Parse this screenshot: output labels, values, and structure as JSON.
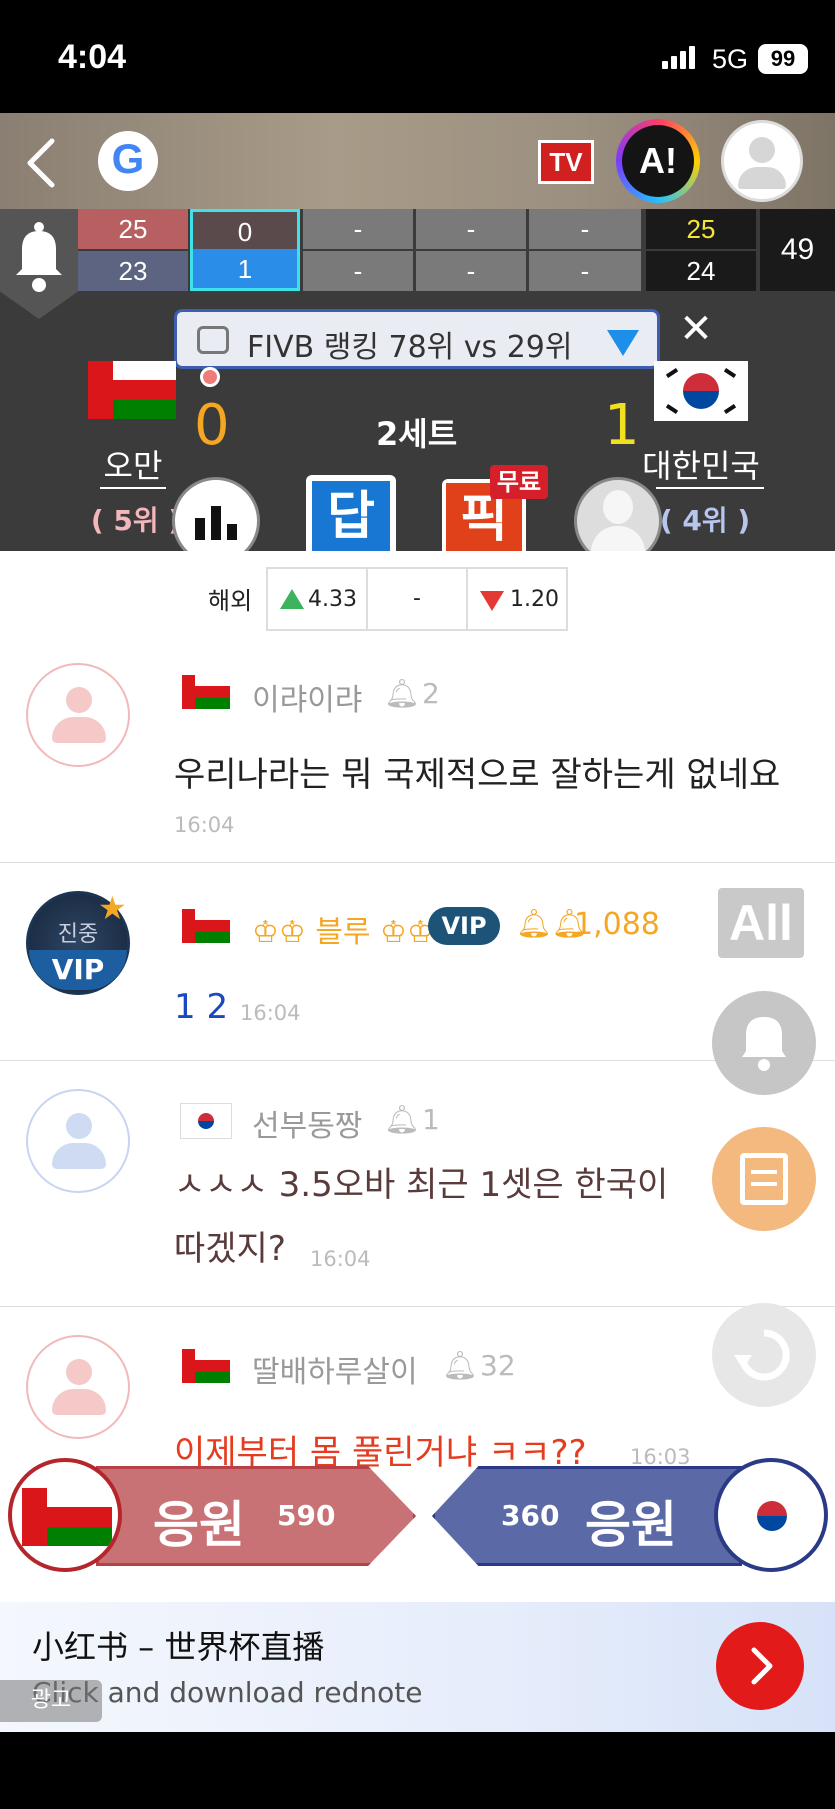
{
  "status_bar": {
    "time": "4:04",
    "network": "5G",
    "battery": "99"
  },
  "header": {
    "tv_label": "TV",
    "ai_label": "A!",
    "google_letter": "G"
  },
  "scoreboard": {
    "home_sets": [
      "25",
      "0",
      "-",
      "-",
      "-"
    ],
    "away_sets": [
      "23",
      "1",
      "-",
      "-",
      "-"
    ],
    "home_current": "25",
    "away_current": "24",
    "total": "49"
  },
  "ranking_pill": {
    "text": "FIVB 랭킹 78위 vs 29위"
  },
  "match": {
    "set_label": "2세트",
    "home": {
      "name": "오만",
      "rank": "( 5위 )",
      "score": "0"
    },
    "away": {
      "name": "대한민국",
      "rank": "( 4위 )",
      "score": "1"
    },
    "answer_label": "답",
    "pick_label": "픽",
    "free_badge": "무료"
  },
  "odds": {
    "label": "해외",
    "home": "4.33",
    "draw": "-",
    "away": "1.20"
  },
  "comments": [
    {
      "nick": "이랴이랴",
      "level": "2",
      "text": "우리나라는 뭐 국제적으로 잘하는게 없네요",
      "time": "16:04",
      "flag": "om"
    },
    {
      "nick": "♔♔ 블루 ♔♔",
      "vip_label": "VIP",
      "level": "1,088",
      "text": "1 2",
      "time": "16:04",
      "flag": "om",
      "avatar_text": "진중",
      "avatar_vip": "VIP"
    },
    {
      "nick": "선부동짱",
      "level": "1",
      "text": "ㅅㅅㅅ 3.5오바 최근 1셋은 한국이",
      "text2": "따겠지?",
      "time": "16:04",
      "flag": "kr"
    },
    {
      "nick": "딸배하루살이",
      "level": "32",
      "text": "이제부터 몸 풀린거냐 ㅋㅋ??",
      "time": "16:03",
      "flag": "om"
    }
  ],
  "side_buttons": {
    "all_label": "All"
  },
  "cheer": {
    "home_label": "응원",
    "home_count": "590",
    "away_label": "응원",
    "away_count": "360"
  },
  "ad": {
    "title": "小红书 – 世界杯直播",
    "subtitle": "Click and download rednote",
    "badge": "광고"
  },
  "colors": {
    "accent_orange": "#f5a623",
    "home_cheer": "#c97276",
    "away_cheer": "#5b6aa6",
    "vip_blue": "#1c5377"
  }
}
